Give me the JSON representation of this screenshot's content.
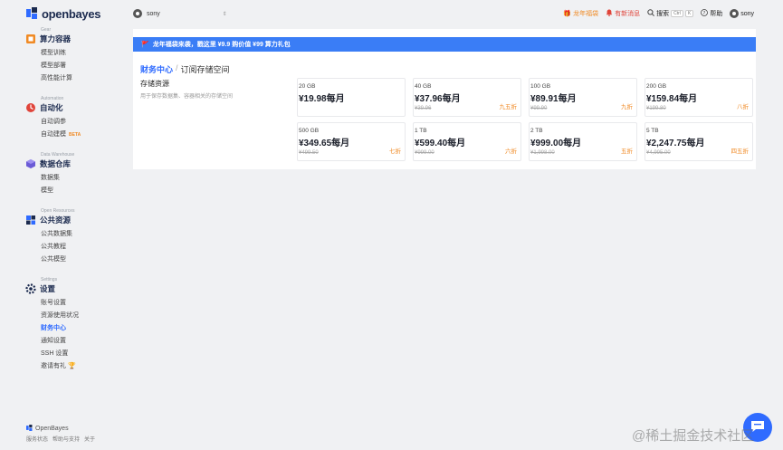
{
  "brand": {
    "name": "openbayes",
    "accent": "#2f6bff"
  },
  "workspace": {
    "name": "sony"
  },
  "topbar": {
    "promo_link": "龙年福袋",
    "news_link": "有新消息",
    "search_label": "搜索",
    "shortcut_a": "Ctrl",
    "shortcut_b": "K",
    "help_label": "帮助",
    "user_name": "sony"
  },
  "sidebar": {
    "groups": [
      {
        "en": "Gear",
        "title": "算力容器",
        "items": [
          "模型训练",
          "模型部署",
          "高性能计算"
        ]
      },
      {
        "en": "Automation",
        "title": "自动化",
        "items": [
          "自动调参",
          "自动建模"
        ],
        "beta": "BETA"
      },
      {
        "en": "Data Warehouse",
        "title": "数据仓库",
        "items": [
          "数据集",
          "模型"
        ]
      },
      {
        "en": "Open Resources",
        "title": "公共资源",
        "items": [
          "公共数据集",
          "公共教程",
          "公共模型"
        ]
      },
      {
        "en": "Settings",
        "title": "设置",
        "items": [
          "账号设置",
          "资源使用状况",
          "财务中心",
          "通知设置",
          "SSH 设置",
          "邀请有礼"
        ]
      }
    ],
    "active_item": "财务中心"
  },
  "footer": {
    "brand": "OpenBayes",
    "links": [
      "服务状态",
      "帮助与支持",
      "关于"
    ]
  },
  "banner": {
    "text": "龙年福袋来袭，戳这里 ¥9.9 购价值 ¥99 算力礼包"
  },
  "breadcrumb": {
    "parent": "财务中心",
    "separator": "/",
    "current": "订阅存储空间"
  },
  "section": {
    "title": "存储资源",
    "description": "用于保存数据集、容器相关的存储空间"
  },
  "plans": [
    {
      "size": "20 GB",
      "price": "¥19.98每月",
      "original": "",
      "discount": ""
    },
    {
      "size": "40 GB",
      "price": "¥37.96每月",
      "original": "¥39.96",
      "discount": "九五折"
    },
    {
      "size": "100 GB",
      "price": "¥89.91每月",
      "original": "¥99.90",
      "discount": "九折"
    },
    {
      "size": "200 GB",
      "price": "¥159.84每月",
      "original": "¥199.80",
      "discount": "八折"
    },
    {
      "size": "500 GB",
      "price": "¥349.65每月",
      "original": "¥499.50",
      "discount": "七折"
    },
    {
      "size": "1 TB",
      "price": "¥599.40每月",
      "original": "¥999.00",
      "discount": "六折"
    },
    {
      "size": "2 TB",
      "price": "¥999.00每月",
      "original": "¥1,998.00",
      "discount": "五折"
    },
    {
      "size": "5 TB",
      "price": "¥2,247.75每月",
      "original": "¥4,995.00",
      "discount": "四五折"
    }
  ],
  "watermark": "@稀土掘金技术社区"
}
